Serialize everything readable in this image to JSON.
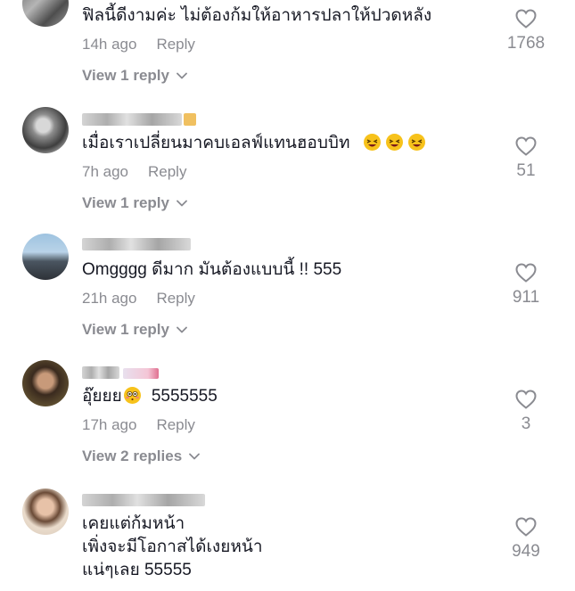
{
  "comments": [
    {
      "text": "ฟิลนี้ดีงามค่ะ ไม่ต้องก้มให้อาหารปลาให้ปวดหลัง",
      "time": "14h ago",
      "reply_label": "Reply",
      "view_replies": "View 1 reply",
      "likes": "1768"
    },
    {
      "text": "เมื่อเราเปลี่ยนมาคบเอลฟ์แทนฮอบบิท",
      "time": "7h ago",
      "reply_label": "Reply",
      "view_replies": "View 1 reply",
      "likes": "51",
      "emoji": [
        "laughing-face-icon",
        "laughing-face-icon",
        "laughing-face-icon"
      ]
    },
    {
      "text": "Omgggg ดีมาก มันต้องแบบนี้ !! 555",
      "time": "21h ago",
      "reply_label": "Reply",
      "view_replies": "View 1 reply",
      "likes": "911"
    },
    {
      "text_before": "อุ๊ยยย",
      "text_after": "5555555",
      "time": "17h ago",
      "reply_label": "Reply",
      "view_replies": "View 2 replies",
      "likes": "3",
      "emoji": [
        "flushed-face-icon"
      ]
    },
    {
      "lines": [
        "เคยแต่ก้มหน้า",
        "เพิ่งจะมีโอกาสได้เงยหน้า",
        "แน่ๆเลย 55555"
      ],
      "likes": "949"
    }
  ],
  "colors": {
    "text": "#161823",
    "muted": "#8a8b91",
    "emoji": "#f7c21b"
  }
}
